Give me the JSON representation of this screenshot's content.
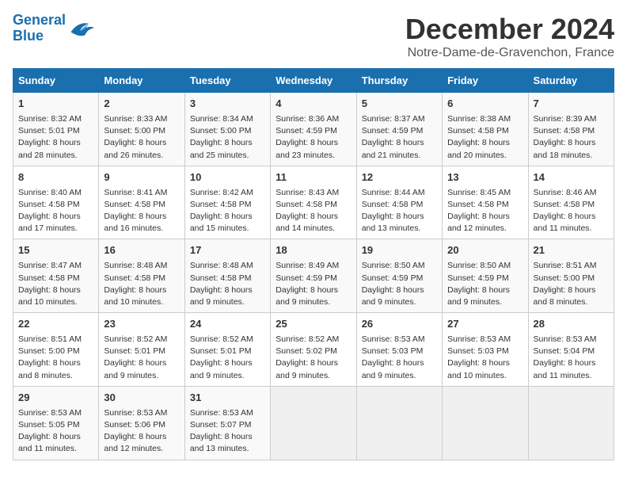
{
  "header": {
    "logo_line1": "General",
    "logo_line2": "Blue",
    "month": "December 2024",
    "location": "Notre-Dame-de-Gravenchon, France"
  },
  "weekdays": [
    "Sunday",
    "Monday",
    "Tuesday",
    "Wednesday",
    "Thursday",
    "Friday",
    "Saturday"
  ],
  "weeks": [
    [
      {
        "day": "1",
        "lines": [
          "Sunrise: 8:32 AM",
          "Sunset: 5:01 PM",
          "Daylight: 8 hours",
          "and 28 minutes."
        ]
      },
      {
        "day": "2",
        "lines": [
          "Sunrise: 8:33 AM",
          "Sunset: 5:00 PM",
          "Daylight: 8 hours",
          "and 26 minutes."
        ]
      },
      {
        "day": "3",
        "lines": [
          "Sunrise: 8:34 AM",
          "Sunset: 5:00 PM",
          "Daylight: 8 hours",
          "and 25 minutes."
        ]
      },
      {
        "day": "4",
        "lines": [
          "Sunrise: 8:36 AM",
          "Sunset: 4:59 PM",
          "Daylight: 8 hours",
          "and 23 minutes."
        ]
      },
      {
        "day": "5",
        "lines": [
          "Sunrise: 8:37 AM",
          "Sunset: 4:59 PM",
          "Daylight: 8 hours",
          "and 21 minutes."
        ]
      },
      {
        "day": "6",
        "lines": [
          "Sunrise: 8:38 AM",
          "Sunset: 4:58 PM",
          "Daylight: 8 hours",
          "and 20 minutes."
        ]
      },
      {
        "day": "7",
        "lines": [
          "Sunrise: 8:39 AM",
          "Sunset: 4:58 PM",
          "Daylight: 8 hours",
          "and 18 minutes."
        ]
      }
    ],
    [
      {
        "day": "8",
        "lines": [
          "Sunrise: 8:40 AM",
          "Sunset: 4:58 PM",
          "Daylight: 8 hours",
          "and 17 minutes."
        ]
      },
      {
        "day": "9",
        "lines": [
          "Sunrise: 8:41 AM",
          "Sunset: 4:58 PM",
          "Daylight: 8 hours",
          "and 16 minutes."
        ]
      },
      {
        "day": "10",
        "lines": [
          "Sunrise: 8:42 AM",
          "Sunset: 4:58 PM",
          "Daylight: 8 hours",
          "and 15 minutes."
        ]
      },
      {
        "day": "11",
        "lines": [
          "Sunrise: 8:43 AM",
          "Sunset: 4:58 PM",
          "Daylight: 8 hours",
          "and 14 minutes."
        ]
      },
      {
        "day": "12",
        "lines": [
          "Sunrise: 8:44 AM",
          "Sunset: 4:58 PM",
          "Daylight: 8 hours",
          "and 13 minutes."
        ]
      },
      {
        "day": "13",
        "lines": [
          "Sunrise: 8:45 AM",
          "Sunset: 4:58 PM",
          "Daylight: 8 hours",
          "and 12 minutes."
        ]
      },
      {
        "day": "14",
        "lines": [
          "Sunrise: 8:46 AM",
          "Sunset: 4:58 PM",
          "Daylight: 8 hours",
          "and 11 minutes."
        ]
      }
    ],
    [
      {
        "day": "15",
        "lines": [
          "Sunrise: 8:47 AM",
          "Sunset: 4:58 PM",
          "Daylight: 8 hours",
          "and 10 minutes."
        ]
      },
      {
        "day": "16",
        "lines": [
          "Sunrise: 8:48 AM",
          "Sunset: 4:58 PM",
          "Daylight: 8 hours",
          "and 10 minutes."
        ]
      },
      {
        "day": "17",
        "lines": [
          "Sunrise: 8:48 AM",
          "Sunset: 4:58 PM",
          "Daylight: 8 hours",
          "and 9 minutes."
        ]
      },
      {
        "day": "18",
        "lines": [
          "Sunrise: 8:49 AM",
          "Sunset: 4:59 PM",
          "Daylight: 8 hours",
          "and 9 minutes."
        ]
      },
      {
        "day": "19",
        "lines": [
          "Sunrise: 8:50 AM",
          "Sunset: 4:59 PM",
          "Daylight: 8 hours",
          "and 9 minutes."
        ]
      },
      {
        "day": "20",
        "lines": [
          "Sunrise: 8:50 AM",
          "Sunset: 4:59 PM",
          "Daylight: 8 hours",
          "and 9 minutes."
        ]
      },
      {
        "day": "21",
        "lines": [
          "Sunrise: 8:51 AM",
          "Sunset: 5:00 PM",
          "Daylight: 8 hours",
          "and 8 minutes."
        ]
      }
    ],
    [
      {
        "day": "22",
        "lines": [
          "Sunrise: 8:51 AM",
          "Sunset: 5:00 PM",
          "Daylight: 8 hours",
          "and 8 minutes."
        ]
      },
      {
        "day": "23",
        "lines": [
          "Sunrise: 8:52 AM",
          "Sunset: 5:01 PM",
          "Daylight: 8 hours",
          "and 9 minutes."
        ]
      },
      {
        "day": "24",
        "lines": [
          "Sunrise: 8:52 AM",
          "Sunset: 5:01 PM",
          "Daylight: 8 hours",
          "and 9 minutes."
        ]
      },
      {
        "day": "25",
        "lines": [
          "Sunrise: 8:52 AM",
          "Sunset: 5:02 PM",
          "Daylight: 8 hours",
          "and 9 minutes."
        ]
      },
      {
        "day": "26",
        "lines": [
          "Sunrise: 8:53 AM",
          "Sunset: 5:03 PM",
          "Daylight: 8 hours",
          "and 9 minutes."
        ]
      },
      {
        "day": "27",
        "lines": [
          "Sunrise: 8:53 AM",
          "Sunset: 5:03 PM",
          "Daylight: 8 hours",
          "and 10 minutes."
        ]
      },
      {
        "day": "28",
        "lines": [
          "Sunrise: 8:53 AM",
          "Sunset: 5:04 PM",
          "Daylight: 8 hours",
          "and 11 minutes."
        ]
      }
    ],
    [
      {
        "day": "29",
        "lines": [
          "Sunrise: 8:53 AM",
          "Sunset: 5:05 PM",
          "Daylight: 8 hours",
          "and 11 minutes."
        ]
      },
      {
        "day": "30",
        "lines": [
          "Sunrise: 8:53 AM",
          "Sunset: 5:06 PM",
          "Daylight: 8 hours",
          "and 12 minutes."
        ]
      },
      {
        "day": "31",
        "lines": [
          "Sunrise: 8:53 AM",
          "Sunset: 5:07 PM",
          "Daylight: 8 hours",
          "and 13 minutes."
        ]
      },
      {
        "day": "",
        "lines": []
      },
      {
        "day": "",
        "lines": []
      },
      {
        "day": "",
        "lines": []
      },
      {
        "day": "",
        "lines": []
      }
    ]
  ]
}
